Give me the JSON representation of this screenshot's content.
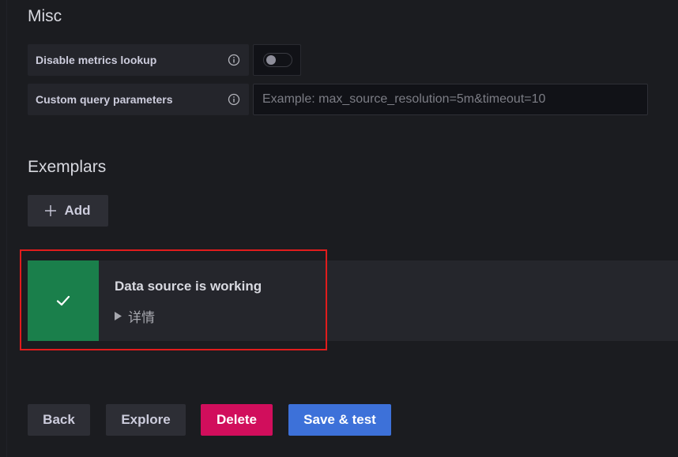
{
  "misc": {
    "title": "Misc",
    "disable_metrics_lookup": {
      "label": "Disable metrics lookup",
      "enabled": false
    },
    "custom_query_parameters": {
      "label": "Custom query parameters",
      "value": "",
      "placeholder": "Example: max_source_resolution=5m&timeout=10"
    }
  },
  "exemplars": {
    "title": "Exemplars",
    "add_label": "Add"
  },
  "alert": {
    "status": "success",
    "title": "Data source is working",
    "details_label": "详情",
    "color": "#1a7f4b"
  },
  "actions": {
    "back_label": "Back",
    "explore_label": "Explore",
    "delete_label": "Delete",
    "save_test_label": "Save & test"
  },
  "colors": {
    "background": "#1b1c20",
    "success": "#1a7f4b",
    "danger": "#d10e5c",
    "primary": "#3d71d9",
    "highlight": "#e11c1c"
  },
  "icons": {
    "info": "info-icon",
    "plus": "plus-icon",
    "check": "check-icon",
    "caret": "caret-right-icon"
  }
}
